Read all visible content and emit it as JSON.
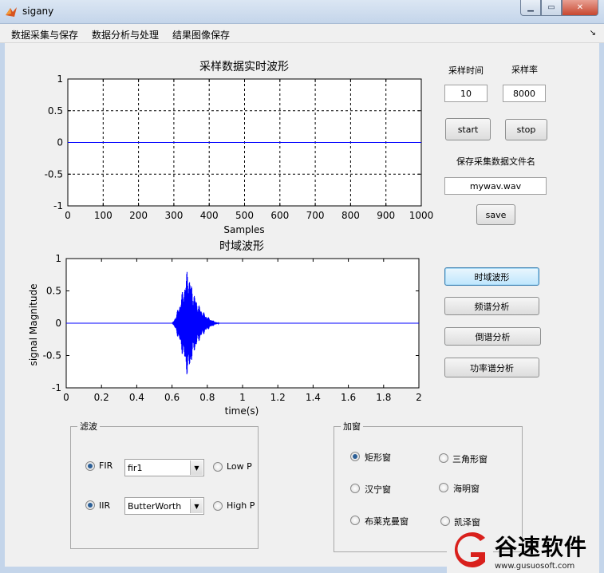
{
  "window": {
    "title": "sigany",
    "min_icon": "minimize-icon",
    "max_icon": "maximize-icon",
    "close_icon": "close-icon"
  },
  "menu": {
    "items": [
      "数据采集与保存",
      "数据分析与处理",
      "结果图像保存"
    ],
    "overflow": "↘"
  },
  "plot1": {
    "title": "采样数据实时波形",
    "xlabel": "Samples",
    "xticks": [
      "0",
      "100",
      "200",
      "300",
      "400",
      "500",
      "600",
      "700",
      "800",
      "900",
      "1000"
    ],
    "yticks": [
      "1",
      "0.5",
      "0",
      "-0.5",
      "-1"
    ],
    "xlim": [
      0,
      1000
    ],
    "ylim": [
      -1,
      1
    ]
  },
  "plot2": {
    "title": "时域波形",
    "xlabel": "time(s)",
    "ylabel": "signal Magnitude",
    "xticks": [
      "0",
      "0.2",
      "0.4",
      "0.6",
      "0.8",
      "1",
      "1.2",
      "1.4",
      "1.6",
      "1.8",
      "2"
    ],
    "yticks": [
      "1",
      "0.5",
      "0",
      "-0.5",
      "-1"
    ],
    "xlim": [
      0,
      2
    ],
    "ylim": [
      -1,
      1
    ],
    "burst": {
      "start": 0.6,
      "peak": 0.69,
      "end": 0.87,
      "peak_amplitude": 0.9
    }
  },
  "chart_data": [
    {
      "type": "line",
      "title": "采样数据实时波形",
      "xlabel": "Samples",
      "ylabel": "",
      "x": [
        0,
        1000
      ],
      "series": [
        {
          "values": [
            0,
            0
          ]
        }
      ],
      "xlim": [
        0,
        1000
      ],
      "ylim": [
        -1,
        1
      ],
      "grid": true
    },
    {
      "type": "line",
      "title": "时域波形",
      "xlabel": "time(s)",
      "ylabel": "signal Magnitude",
      "x": [
        0,
        0.6,
        0.69,
        0.8,
        0.87,
        2
      ],
      "series": [
        {
          "values": [
            0,
            0,
            0.9,
            0.5,
            0,
            0
          ]
        }
      ],
      "xlim": [
        0,
        2
      ],
      "ylim": [
        -1,
        1
      ],
      "grid": false
    }
  ],
  "sampling": {
    "time_label": "采样时间",
    "rate_label": "采样率",
    "time_value": "10",
    "rate_value": "8000",
    "start_label": "start",
    "stop_label": "stop",
    "filename_label": "保存采集数据文件名",
    "filename_value": "mywav.wav",
    "save_label": "save"
  },
  "analysis_buttons": [
    "时域波形",
    "频谱分析",
    "倒谱分析",
    "功率谱分析"
  ],
  "filter": {
    "legend": "滤波",
    "fir_label": "FIR",
    "iir_label": "IIR",
    "fir_select": "fir1",
    "iir_select": "ButterWorth",
    "lowpass_label": "Low P",
    "highpass_label": "High P"
  },
  "window_group": {
    "legend": "加窗",
    "options": [
      "矩形窗",
      "三角形窗",
      "汉宁窗",
      "海明窗",
      "布莱克曼窗",
      "凯泽窗"
    ]
  },
  "watermark": {
    "brand": "谷速软件",
    "url": "www.gusuosoft.com"
  },
  "colors": {
    "line": "#0000ff",
    "grid": "#000000",
    "accent_red": "#d9201c"
  }
}
